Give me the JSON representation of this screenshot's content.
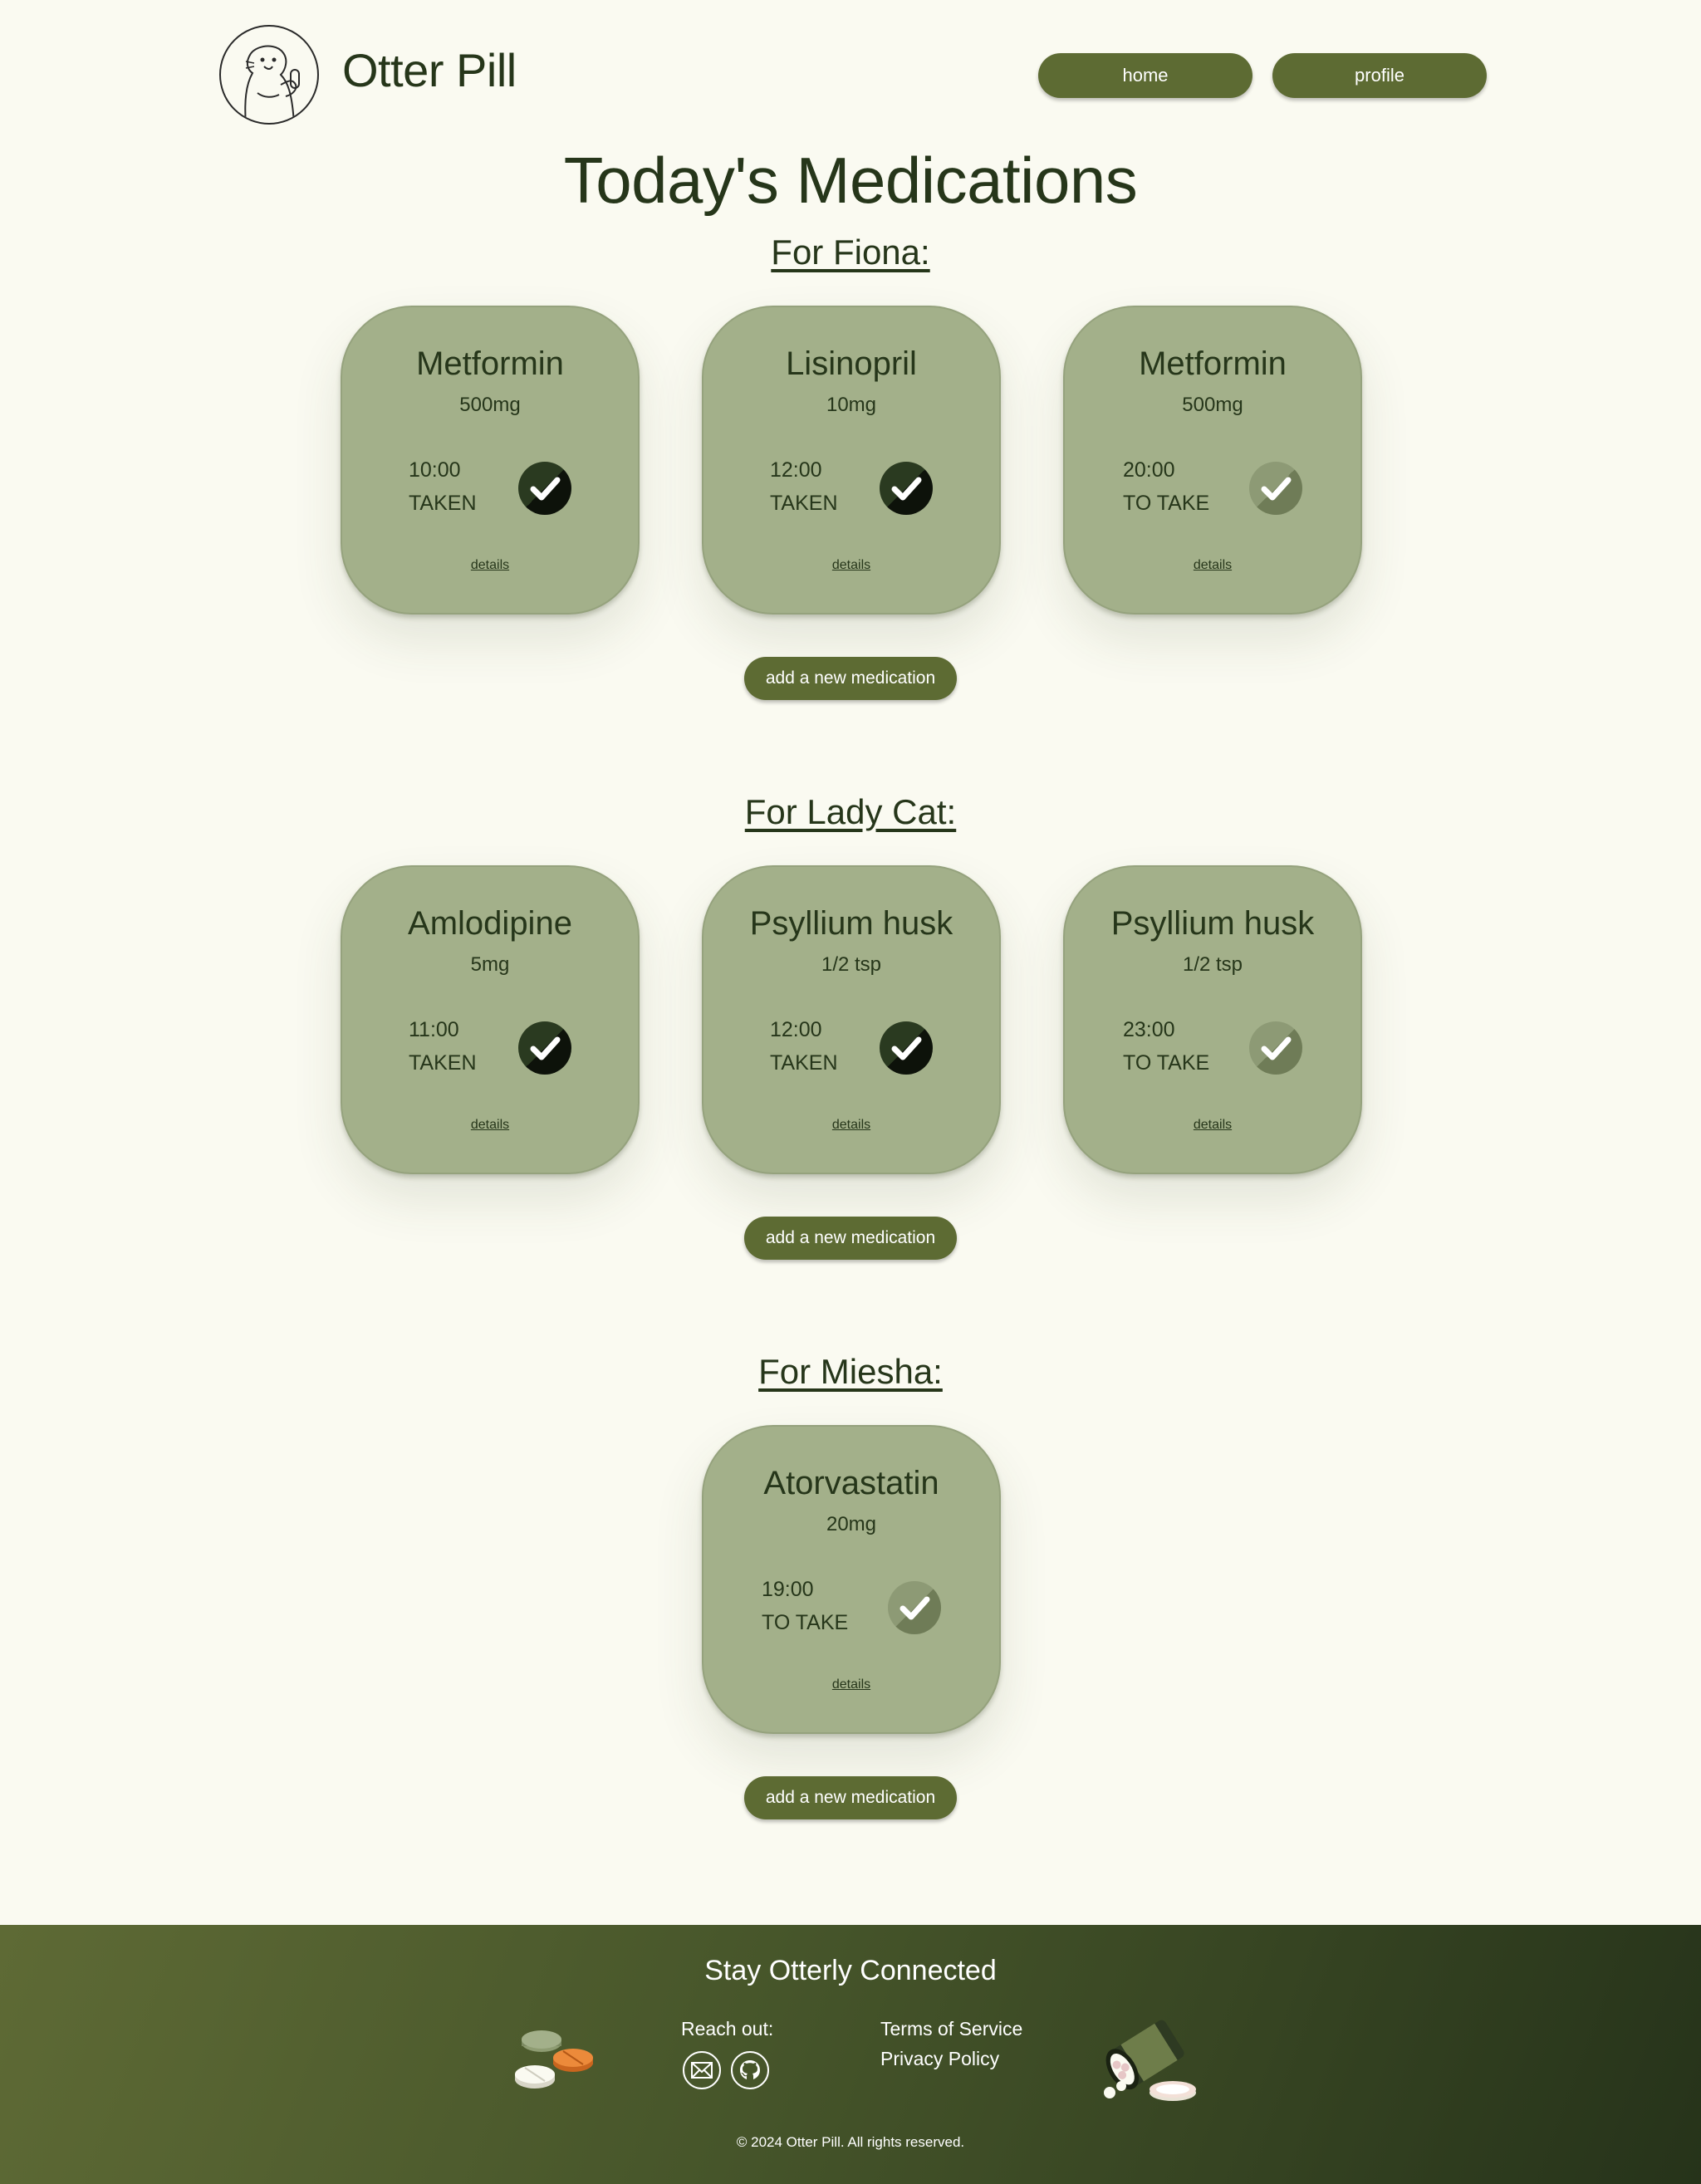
{
  "header": {
    "brand": "Otter Pill",
    "nav": {
      "home": "home",
      "profile": "profile"
    }
  },
  "page_title": "Today's Medications",
  "sections": [
    {
      "title": "For Fiona:",
      "add_label": "add a new medication",
      "cards": [
        {
          "name": "Metformin",
          "dose": "500mg",
          "time": "10:00",
          "status": "TAKEN",
          "taken": true,
          "details": "details"
        },
        {
          "name": "Lisinopril",
          "dose": "10mg",
          "time": "12:00",
          "status": "TAKEN",
          "taken": true,
          "details": "details"
        },
        {
          "name": "Metformin",
          "dose": "500mg",
          "time": "20:00",
          "status": "TO TAKE",
          "taken": false,
          "details": "details"
        }
      ]
    },
    {
      "title": "For Lady Cat:",
      "add_label": "add a new medication",
      "cards": [
        {
          "name": "Amlodipine",
          "dose": "5mg",
          "time": "11:00",
          "status": "TAKEN",
          "taken": true,
          "details": "details"
        },
        {
          "name": "Psyllium husk",
          "dose": "1/2 tsp",
          "time": "12:00",
          "status": "TAKEN",
          "taken": true,
          "details": "details"
        },
        {
          "name": "Psyllium husk",
          "dose": "1/2 tsp",
          "time": "23:00",
          "status": "TO TAKE",
          "taken": false,
          "details": "details"
        }
      ]
    },
    {
      "title": "For Miesha:",
      "add_label": "add a new medication",
      "cards": [
        {
          "name": "Atorvastatin",
          "dose": "20mg",
          "time": "19:00",
          "status": "TO TAKE",
          "taken": false,
          "details": "details"
        }
      ]
    }
  ],
  "footer": {
    "title": "Stay Otterly Connected",
    "reach_out": "Reach out:",
    "icons": {
      "mail": "mail-icon",
      "github": "github-icon"
    },
    "terms": "Terms of Service",
    "privacy": "Privacy Policy",
    "copyright": "© 2024 Otter Pill. All rights reserved."
  },
  "colors": {
    "background": "#fafaf1",
    "card": "#a3b08a",
    "button": "#5d6b33",
    "text": "#26361a"
  }
}
